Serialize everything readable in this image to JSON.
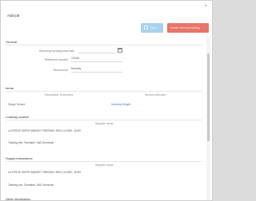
{
  "dialog": {
    "title": "Add job",
    "close_glyph": "×"
  },
  "toolbar": {
    "save_label": "Save",
    "create_label": "Create recurring booking"
  },
  "general": {
    "title": "General",
    "start_date_label": "Recurring booking start date",
    "reference_label": "Reference number",
    "reference_value": "1234A",
    "recurrence_label": "Recurrence",
    "recurrence_value": "Monthly"
  },
  "items": {
    "title": "Items",
    "col_description": "Description of services",
    "col_service": "Service selection",
    "item_label": "Single Tenant",
    "item_link": "Kimberly Bright"
  },
  "loading": {
    "title": "Loading location",
    "supplier_label": "Supplier name",
    "address": "LA FORGE SUPER MARKET FREEWAY, 9000, LA SIDE, 11009",
    "contact": "Tracking info: Timetable: J&B Chemicals"
  },
  "supply": {
    "title": "Supply instructions",
    "supplier_label": "Supplier name",
    "address": "LA FORGE SUPER MARKET FREEWAY, 9000, LA SIDE, 11009",
    "contact": "Tracking info: Timetable: J&B Chemicals"
  },
  "extra": {
    "title": "Other information"
  },
  "colors": {
    "save_button": "#a9d2ee",
    "create_button": "#e8736a",
    "link": "#3a6fd0"
  },
  "icons": {
    "calendar": "calendar-icon",
    "save": "save-icon",
    "close": "close-icon"
  }
}
